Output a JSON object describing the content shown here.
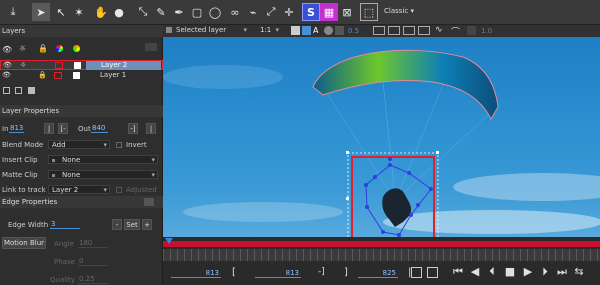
{
  "toolbar": {
    "workspace": "Classic",
    "icons": [
      "export-icon",
      "arrow-select-icon",
      "node-select-icon",
      "magic-wand-icon",
      "hand-icon",
      "zoom-icon",
      "transform-icon",
      "brush-icon",
      "pen-icon",
      "rectangle-icon",
      "ellipse-icon",
      "link-icon",
      "link-off-icon",
      "fit-icon",
      "move-icon",
      "s-icon",
      "grid-icon",
      "mask-icon",
      "frame-icon"
    ],
    "s_label": "S"
  },
  "layers": {
    "title": "Layers",
    "items": [
      {
        "name": "Layer 2",
        "selected": true
      },
      {
        "name": "Layer 1",
        "selected": false
      }
    ]
  },
  "viewbar": {
    "selected_layer": "Selected layer",
    "ratio": "1:1",
    "opacity": "0.5",
    "right_value": "1.0"
  },
  "layer_properties": {
    "title": "Layer Properties",
    "in_label": "In",
    "in_value": "813",
    "out_label": "Out",
    "out_value": "840",
    "blend_mode_label": "Blend Mode",
    "blend_mode_value": "Add",
    "invert_label": "Invert",
    "insert_clip_label": "Insert Clip",
    "insert_clip_value": "None",
    "matte_clip_label": "Matte Clip",
    "matte_clip_value": "None",
    "link_track_label": "Link to track",
    "link_track_value": "Layer 2",
    "adjusted_label": "Adjusted"
  },
  "edge_properties": {
    "title": "Edge Properties",
    "edge_width_label": "Edge Width",
    "edge_width_value": "3",
    "set_label": "Set",
    "minus_label": "-",
    "plus_label": "+",
    "motion_blur_label": "Motion Blur",
    "angle_label": "Angle",
    "angle_value": "180",
    "phase_label": "Phase",
    "phase_value": "0",
    "quality_label": "Quality",
    "quality_value": "0.25"
  },
  "timeline": {
    "current_frame": "813",
    "range_start": "813",
    "range_end": "825",
    "bracket_open": "[",
    "bracket_close": "]",
    "in_mark": "[-",
    "out_mark": "-]"
  },
  "colors": {
    "accent": "#4a90d9",
    "selection_red": "#e0202a",
    "timeline_bar": "#c8102e",
    "sky": "#2a8ed0"
  }
}
